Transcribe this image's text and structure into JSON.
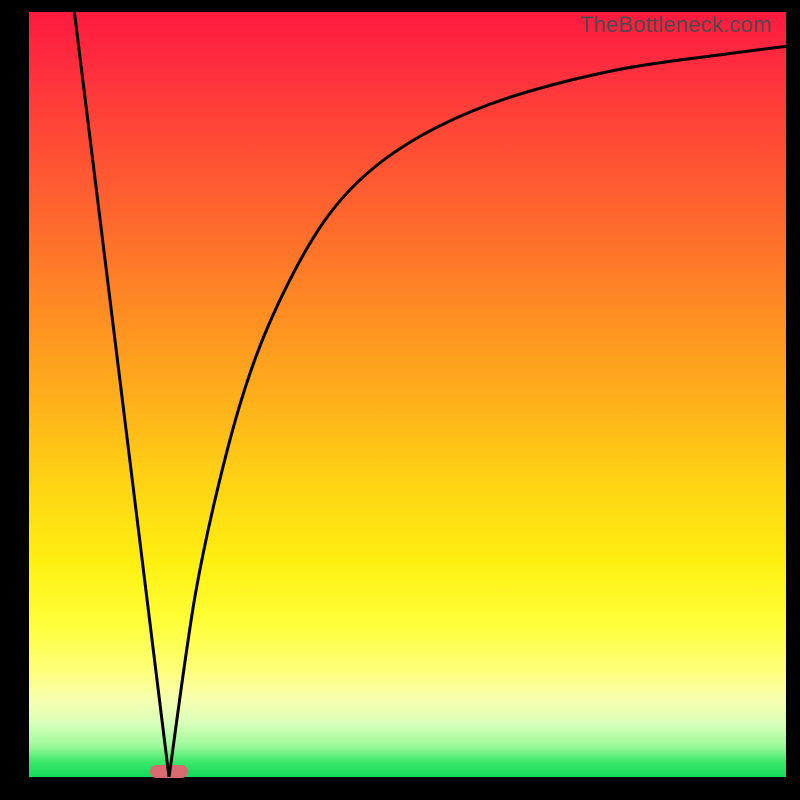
{
  "watermark": "TheBottleneck.com",
  "colors": {
    "frame": "#000000",
    "curve": "#000000",
    "marker": "#d96a6f",
    "gradient_top": "#ff1a3f",
    "gradient_bottom": "#14d95a"
  },
  "chart_data": {
    "type": "line",
    "title": "",
    "xlabel": "",
    "ylabel": "",
    "xlim": [
      0,
      100
    ],
    "ylim": [
      0,
      100
    ],
    "axes_visible": false,
    "grid": false,
    "background": "red-yellow-green vertical gradient",
    "marker": {
      "x_center": 18.5,
      "width_pct": 5,
      "y": 0
    },
    "series": [
      {
        "name": "left-line",
        "x": [
          6,
          18.5
        ],
        "y": [
          100,
          0
        ]
      },
      {
        "name": "right-curve",
        "x": [
          18.5,
          22,
          26,
          30,
          35,
          40,
          46,
          54,
          64,
          78,
          92,
          100
        ],
        "y": [
          0,
          24,
          42,
          55,
          66,
          74,
          80,
          85,
          89,
          92.5,
          94.5,
          95.5
        ]
      }
    ]
  }
}
